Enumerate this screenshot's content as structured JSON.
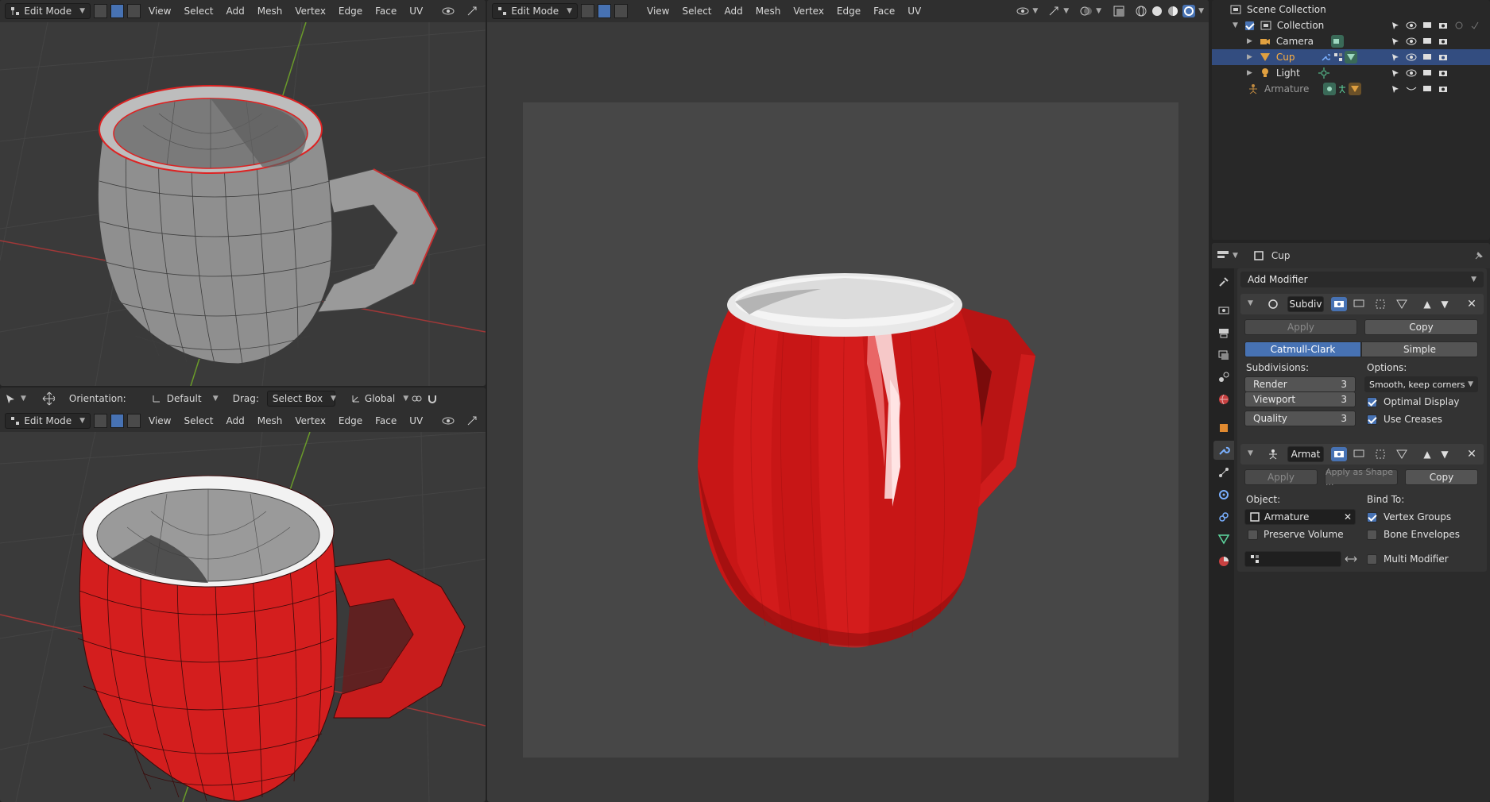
{
  "viewport_header": {
    "mode": "Edit Mode",
    "menus": [
      "View",
      "Select",
      "Add",
      "Mesh",
      "Vertex",
      "Edge",
      "Face",
      "UV"
    ]
  },
  "tool_header": {
    "orientation_label": "Orientation:",
    "orientation_value": "Default",
    "drag_label": "Drag:",
    "drag_value": "Select Box",
    "transform_value": "Global"
  },
  "outliner": {
    "scene_collection": "Scene Collection",
    "items": [
      {
        "label": "Collection"
      },
      {
        "label": "Camera"
      },
      {
        "label": "Cup"
      },
      {
        "label": "Light"
      },
      {
        "label": "Armature"
      }
    ]
  },
  "properties": {
    "object_name": "Cup",
    "add_modifier": "Add Modifier",
    "subdiv": {
      "name": "Subdiv",
      "apply": "Apply",
      "copy": "Copy",
      "mode_a": "Catmull-Clark",
      "mode_b": "Simple",
      "subdivisions_label": "Subdivisions:",
      "options_label": "Options:",
      "render_label": "Render",
      "render_value": "3",
      "viewport_label": "Viewport",
      "viewport_value": "3",
      "quality_label": "Quality",
      "quality_value": "3",
      "uv_option": "Smooth, keep corners",
      "optimal_display": "Optimal Display",
      "use_creases": "Use Creases"
    },
    "armature": {
      "name": "Armat",
      "apply": "Apply",
      "apply_shape": "Apply as Shape ...",
      "copy": "Copy",
      "object_label": "Object:",
      "object_value": "Armature",
      "bind_label": "Bind To:",
      "preserve_volume": "Preserve Volume",
      "vertex_groups": "Vertex Groups",
      "bone_envelopes": "Bone Envelopes",
      "multi_modifier": "Multi Modifier"
    }
  },
  "colors": {
    "accent": "#4772b3",
    "cup_red": "#d81c1c",
    "selection_row": "#334d80"
  }
}
